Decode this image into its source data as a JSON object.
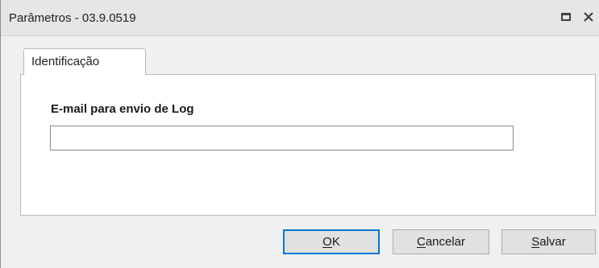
{
  "window": {
    "title": "Parâmetros - 03.9.0519",
    "controls": {
      "restore_icon": "restore-icon",
      "close_icon": "close-icon"
    }
  },
  "tabs": [
    {
      "label": "Identificação",
      "active": true
    }
  ],
  "form": {
    "email_label": "E-mail para envio de Log",
    "email_value": "",
    "email_placeholder": ""
  },
  "buttons": {
    "ok": {
      "label": "OK",
      "accelerator": "O"
    },
    "cancel": {
      "label": "Cancelar",
      "accelerator": "C"
    },
    "save": {
      "label": "Salvar",
      "accelerator": "S"
    }
  },
  "colors": {
    "default_button_border": "#0078d7",
    "button_face": "#e1e1e1",
    "window_background": "#f0f0f0",
    "title_bar": "#e6e6e6"
  }
}
